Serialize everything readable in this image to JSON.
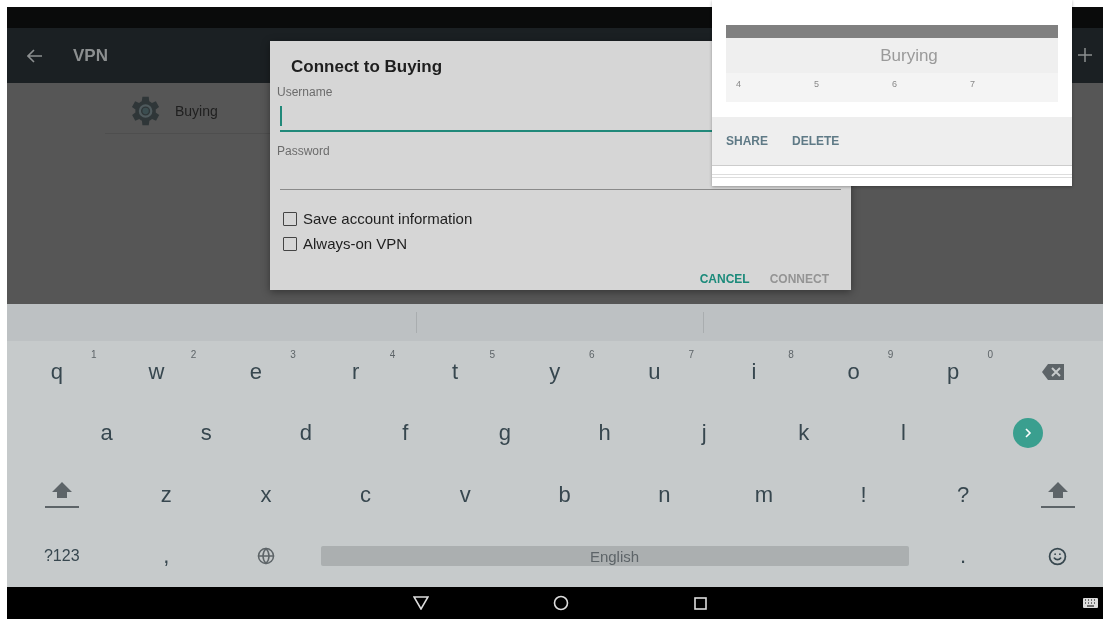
{
  "app_bar": {
    "title": "VPN"
  },
  "vpn_list": [
    {
      "name": "Buying"
    }
  ],
  "dialog": {
    "title": "Connect to Buying",
    "fields": [
      {
        "label": "Username",
        "focused": true
      },
      {
        "label": "Password",
        "focused": false
      }
    ],
    "checkboxes": [
      {
        "label": "Save account information",
        "checked": false
      },
      {
        "label": "Always-on VPN",
        "checked": false
      }
    ],
    "buttons": [
      {
        "label": "CANCEL",
        "disabled": false
      },
      {
        "label": "CONNECT",
        "disabled": true
      }
    ]
  },
  "preview": {
    "title": "Burying",
    "number_hints": [
      "4",
      "5",
      "6",
      "7"
    ],
    "actions": [
      "SHARE",
      "DELETE"
    ]
  },
  "keyboard": {
    "letter_rows": [
      [
        {
          "kind": "char",
          "label": "q",
          "hint": "1"
        },
        {
          "kind": "char",
          "label": "w",
          "hint": "2"
        },
        {
          "kind": "char",
          "label": "e",
          "hint": "3"
        },
        {
          "kind": "char",
          "label": "r",
          "hint": "4"
        },
        {
          "kind": "char",
          "label": "t",
          "hint": "5"
        },
        {
          "kind": "char",
          "label": "y",
          "hint": "6"
        },
        {
          "kind": "char",
          "label": "u",
          "hint": "7"
        },
        {
          "kind": "char",
          "label": "i",
          "hint": "8"
        },
        {
          "kind": "char",
          "label": "o",
          "hint": "9"
        },
        {
          "kind": "char",
          "label": "p",
          "hint": "0"
        },
        {
          "kind": "backspace"
        }
      ],
      [
        {
          "kind": "char",
          "label": "a"
        },
        {
          "kind": "char",
          "label": "s"
        },
        {
          "kind": "char",
          "label": "d"
        },
        {
          "kind": "char",
          "label": "f"
        },
        {
          "kind": "char",
          "label": "g"
        },
        {
          "kind": "char",
          "label": "h"
        },
        {
          "kind": "char",
          "label": "j"
        },
        {
          "kind": "char",
          "label": "k"
        },
        {
          "kind": "char",
          "label": "l"
        },
        {
          "kind": "enter"
        }
      ],
      [
        {
          "kind": "shift"
        },
        {
          "kind": "char",
          "label": "z"
        },
        {
          "kind": "char",
          "label": "x"
        },
        {
          "kind": "char",
          "label": "c"
        },
        {
          "kind": "char",
          "label": "v"
        },
        {
          "kind": "char",
          "label": "b"
        },
        {
          "kind": "char",
          "label": "n"
        },
        {
          "kind": "char",
          "label": "m"
        },
        {
          "kind": "char",
          "label": "!"
        },
        {
          "kind": "char",
          "label": "?"
        },
        {
          "kind": "shift"
        }
      ]
    ],
    "bottom_row": [
      {
        "kind": "symbols",
        "label": "?123"
      },
      {
        "kind": "char",
        "label": ","
      },
      {
        "kind": "globe"
      },
      {
        "kind": "space",
        "label": "English"
      },
      {
        "kind": "char",
        "label": "."
      },
      {
        "kind": "emoji"
      }
    ]
  }
}
